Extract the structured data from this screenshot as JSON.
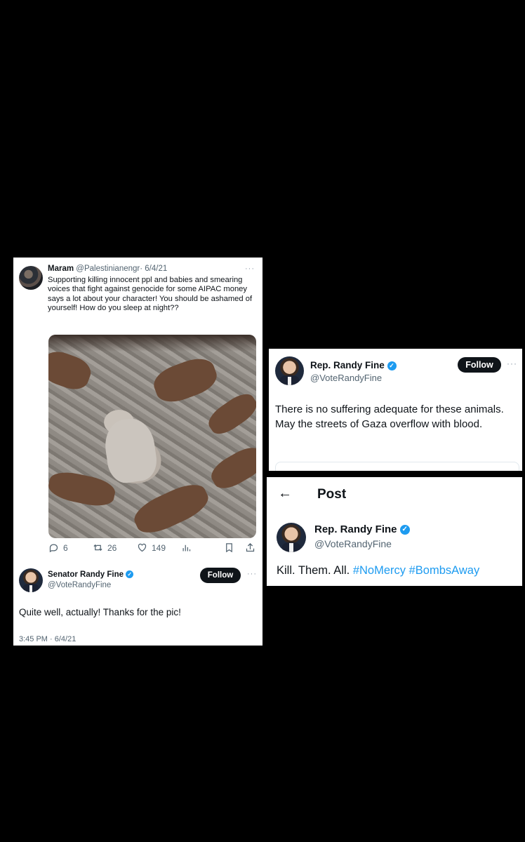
{
  "left_card": {
    "reply": {
      "name": "Maram",
      "handle": "@Palestinianengr",
      "date": "· 6/4/21",
      "text": "Supporting killing innocent ppl and babies and smearing voices that fight against genocide for some AIPAC money says a lot about your character! You should be ashamed of yourself! How do you sleep at night??",
      "more": "···",
      "actions": {
        "replies": "6",
        "retweets": "26",
        "likes": "149"
      }
    },
    "tweet": {
      "name": "Senator Randy Fine",
      "handle": "@VoteRandyFine",
      "follow_label": "Follow",
      "more": "···",
      "text": "Quite well, actually!  Thanks for the pic!",
      "timestamp": "3:45 PM · 6/4/21"
    }
  },
  "top_right_card": {
    "name": "Rep. Randy Fine",
    "handle": "@VoteRandyFine",
    "follow_label": "Follow",
    "more": "···",
    "text": "There is no suffering adequate for these animals.  May the streets of Gaza overflow with blood."
  },
  "bottom_right_card": {
    "header_title": "Post",
    "name": "Rep. Randy Fine",
    "handle": "@VoteRandyFine",
    "text_plain": "Kill.  Them.  All.",
    "hashtag1": "#NoMercy",
    "hashtag2": "#BombsAway"
  },
  "colors": {
    "verified": "#1d9bf0",
    "background": "#000000",
    "follow_button": "#0f1419"
  }
}
